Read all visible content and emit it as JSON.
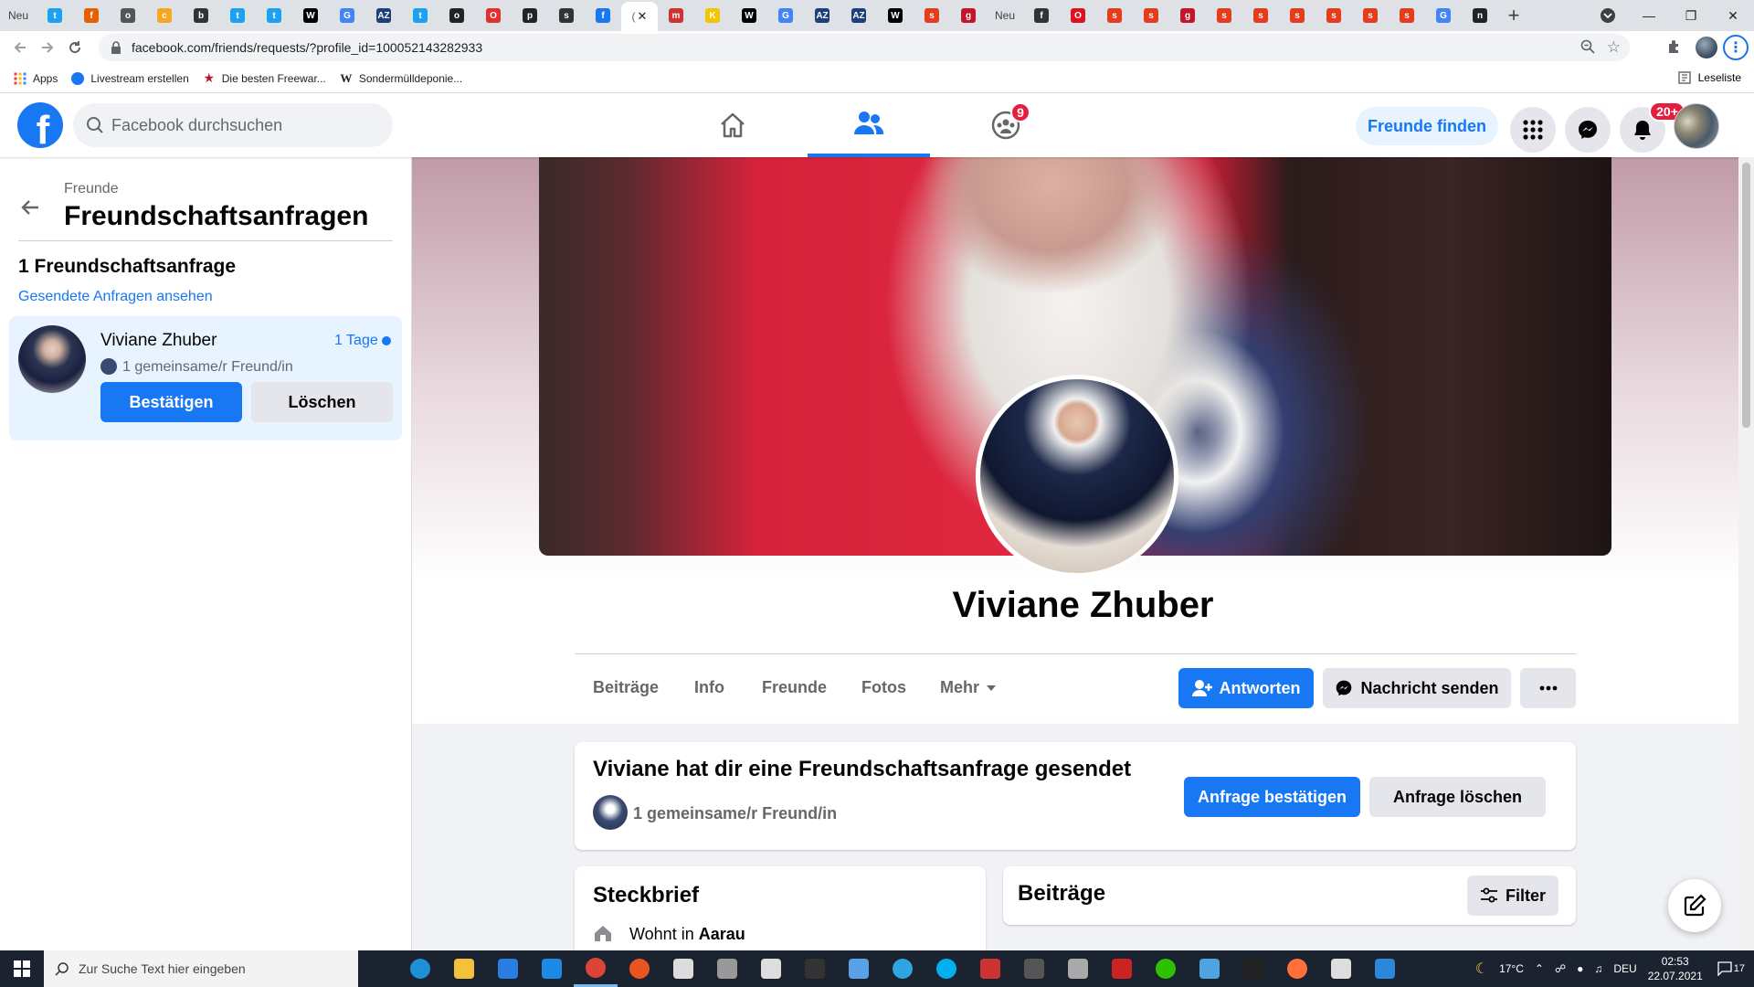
{
  "browser": {
    "tabs": [
      {
        "label": "Neu",
        "color": "#888"
      },
      {
        "icon": "twitter",
        "color": "#1da1f2"
      },
      {
        "icon": "firefox",
        "color": "#e66000"
      },
      {
        "icon": "globe",
        "color": "#555"
      },
      {
        "icon": "cookie",
        "color": "#f5a623"
      },
      {
        "icon": "bell",
        "color": "#333"
      },
      {
        "icon": "twitter",
        "color": "#1da1f2"
      },
      {
        "icon": "twitter",
        "color": "#1da1f2"
      },
      {
        "icon": "wikipedia",
        "color": "#000"
      },
      {
        "icon": "google",
        "color": "#4285f4"
      },
      {
        "icon": "az",
        "color": "#1d3f7a"
      },
      {
        "icon": "twitter",
        "color": "#1da1f2"
      },
      {
        "icon": "target",
        "color": "#222"
      },
      {
        "icon": "opera",
        "color": "#e03030"
      },
      {
        "icon": "printer",
        "color": "#222"
      },
      {
        "icon": "spiral",
        "color": "#333"
      },
      {
        "icon": "facebook",
        "color": "#1877f2"
      }
    ],
    "tabs_after": [
      {
        "icon": "film",
        "color": "#c33"
      },
      {
        "icon": "k",
        "color": "#f5c400"
      },
      {
        "icon": "wikipedia",
        "color": "#000"
      },
      {
        "icon": "google",
        "color": "#4285f4"
      },
      {
        "icon": "az",
        "color": "#1d3f7a"
      },
      {
        "icon": "az",
        "color": "#1d3f7a"
      },
      {
        "icon": "wikipedia",
        "color": "#000"
      },
      {
        "icon": "shield",
        "color": "#e63c1e"
      },
      {
        "icon": "gift",
        "color": "#c0172c"
      },
      {
        "label": "Neu",
        "color": "#888"
      },
      {
        "icon": "feather",
        "color": "#333"
      },
      {
        "icon": "opera",
        "color": "#d12"
      },
      {
        "icon": "shield",
        "color": "#e63c1e"
      },
      {
        "icon": "shield",
        "color": "#e63c1e"
      },
      {
        "icon": "gift",
        "color": "#c0172c"
      },
      {
        "icon": "shield",
        "color": "#e63c1e"
      },
      {
        "icon": "shield",
        "color": "#e63c1e"
      },
      {
        "icon": "shield",
        "color": "#e63c1e"
      },
      {
        "icon": "shield",
        "color": "#e63c1e"
      },
      {
        "icon": "shield",
        "color": "#e63c1e"
      },
      {
        "icon": "shield",
        "color": "#e63c1e"
      },
      {
        "icon": "google",
        "color": "#4285f4"
      },
      {
        "icon": "newspaper",
        "color": "#222"
      }
    ],
    "url": "facebook.com/friends/requests/?profile_id=100052143282933",
    "bookmarks": [
      {
        "label": "Apps",
        "icon": "apps-grid",
        "color": "#e8453c"
      },
      {
        "label": "Livestream erstellen",
        "icon": "facebook",
        "color": "#1877f2"
      },
      {
        "label": "Die besten Freewar...",
        "icon": "star",
        "color": "#c0172c"
      },
      {
        "label": "Sondermülldeponie...",
        "icon": "wikipedia",
        "color": "#000"
      }
    ],
    "reading_list": "Leseliste"
  },
  "facebook": {
    "search_placeholder": "Facebook durchsuchen",
    "groups_badge": "9",
    "find_friends": "Freunde finden",
    "notifications_badge": "20+",
    "brand_color": "#1877f2"
  },
  "left_panel": {
    "breadcrumb": "Freunde",
    "title": "Freundschaftsanfragen",
    "request_count": "1 Freundschaftsanfrage",
    "sent_link": "Gesendete Anfragen ansehen",
    "request": {
      "name": "Viviane Zhuber",
      "time": "1 Tage",
      "mutual": "1 gemeinsame/r Freund/in",
      "confirm": "Bestätigen",
      "delete": "Löschen"
    }
  },
  "profile": {
    "name": "Viviane Zhuber",
    "tabs": [
      "Beiträge",
      "Info",
      "Freunde",
      "Fotos",
      "Mehr"
    ],
    "reply": "Antworten",
    "message": "Nachricht senden",
    "sent_request_title": "Viviane hat dir eine Freundschaftsanfrage gesendet",
    "sent_request_mutual": "1 gemeinsame/r Freund/in",
    "confirm_request": "Anfrage bestätigen",
    "delete_request": "Anfrage löschen",
    "intro_title": "Steckbrief",
    "lives_in_prefix": "Wohnt in",
    "lives_in_city": "Aarau",
    "posts_title": "Beiträge",
    "filter": "Filter"
  },
  "taskbar": {
    "search_placeholder": "Zur Suche Text hier eingeben",
    "apps": [
      {
        "icon": "edge",
        "color": "#1e90d8"
      },
      {
        "icon": "explorer",
        "color": "#f3c13a"
      },
      {
        "icon": "store",
        "color": "#2a7de1"
      },
      {
        "icon": "mail",
        "color": "#1e88e5"
      },
      {
        "icon": "chrome",
        "color": "#db4437",
        "open": true
      },
      {
        "icon": "ubuntu",
        "color": "#e95420"
      },
      {
        "icon": "app",
        "color": "#dcdcdc"
      },
      {
        "icon": "spider",
        "color": "#999"
      },
      {
        "icon": "inkscape",
        "color": "#ddd"
      },
      {
        "icon": "live",
        "color": "#333"
      },
      {
        "icon": "cloud",
        "color": "#5aa0e6"
      },
      {
        "icon": "telegram",
        "color": "#2ca5e0"
      },
      {
        "icon": "skype",
        "color": "#00aff0"
      },
      {
        "icon": "grid",
        "color": "#c33"
      },
      {
        "icon": "kali",
        "color": "#555"
      },
      {
        "icon": "tools",
        "color": "#aaa"
      },
      {
        "icon": "voicemeeter",
        "color": "#c22"
      },
      {
        "icon": "wechat",
        "color": "#2dc100"
      },
      {
        "icon": "window",
        "color": "#4fa3e0"
      },
      {
        "icon": "terminal",
        "color": "#222"
      },
      {
        "icon": "firefox",
        "color": "#ff7139"
      },
      {
        "icon": "notepad",
        "color": "#ddd"
      },
      {
        "icon": "photos",
        "color": "#2b88d8"
      }
    ],
    "weather": "17°C",
    "language": "DEU",
    "time": "02:53",
    "date": "22.07.2021",
    "notifications": "17"
  }
}
